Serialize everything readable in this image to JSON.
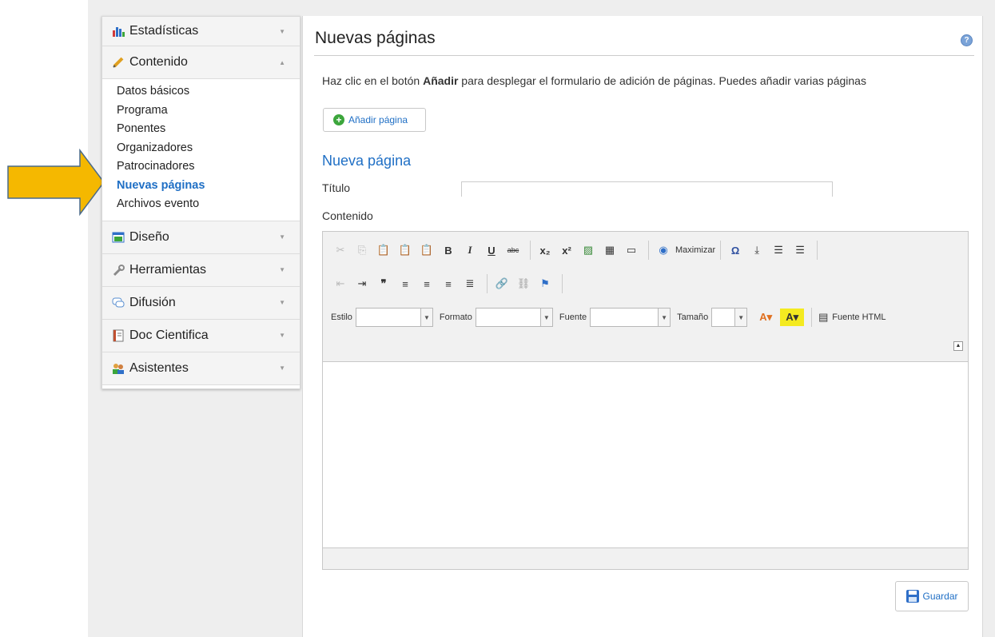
{
  "sidebar": {
    "estadisticas": "Estadísticas",
    "contenido": "Contenido",
    "contenido_items": [
      "Datos básicos",
      "Programa",
      "Ponentes",
      "Organizadores",
      "Patrocinadores",
      "Nuevas páginas",
      "Archivos evento"
    ],
    "diseno": "Diseño",
    "herramientas": "Herramientas",
    "difusion": "Difusión",
    "doc_cientifica": "Doc Cientifica",
    "asistentes": "Asistentes"
  },
  "main": {
    "title": "Nuevas páginas",
    "intro_pre": "Haz clic en el botón ",
    "intro_bold": "Añadir",
    "intro_post": " para desplegar el formulario de adición de páginas. Puedes añadir varias páginas",
    "add_button": "Añadir página",
    "section_title": "Nueva página",
    "titulo_label": "Título",
    "titulo_value": "",
    "contenido_label": "Contenido",
    "save_button": "Guardar"
  },
  "editor": {
    "maximizar": "Maximizar",
    "estilo": "Estilo",
    "formato": "Formato",
    "fuente": "Fuente",
    "tamano": "Tamaño",
    "fuente_html": "Fuente HTML"
  },
  "colors": {
    "accent": "#1f6fc5",
    "arrow": "#f5b800"
  }
}
